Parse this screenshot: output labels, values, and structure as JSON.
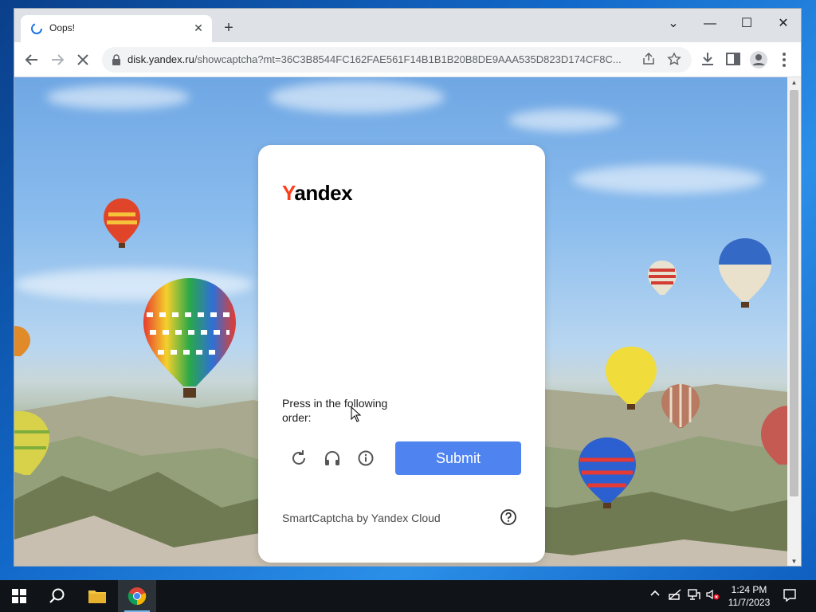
{
  "browser": {
    "tab": {
      "title": "Oops!",
      "close": "✕"
    },
    "new_tab": "+",
    "window_controls": {
      "dropdown": "⌄",
      "minimize": "—",
      "maximize": "☐",
      "close": "✕"
    },
    "url_host": "disk.yandex.ru",
    "url_rest": "/showcaptcha?mt=36C3B8544FC162FAE561F14B1B1B20B8DE9AAA535D823D174CF8C..."
  },
  "captcha": {
    "logo_first": "Y",
    "logo_rest": "andex",
    "instruction": "Press in the following order:",
    "submit_label": "Submit",
    "footer": "SmartCaptcha by Yandex Cloud"
  },
  "taskbar": {
    "time": "1:24 PM",
    "date": "11/7/2023"
  },
  "colors": {
    "accent": "#4f83ef",
    "yandex_red": "#fc3f1d"
  }
}
